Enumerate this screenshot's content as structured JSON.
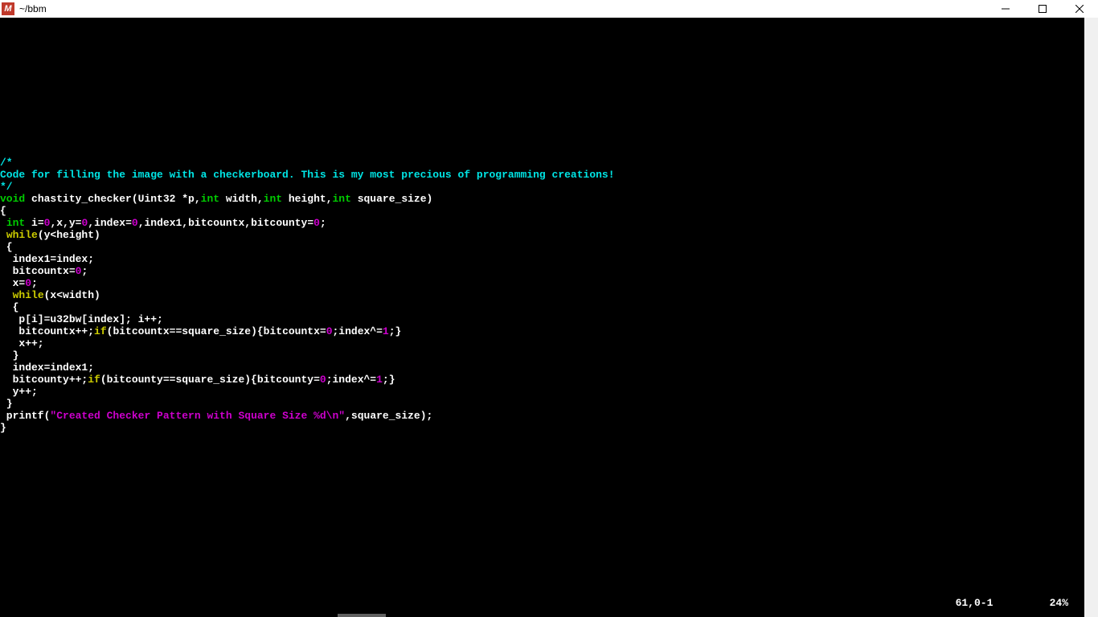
{
  "window": {
    "title": "~/bbm",
    "app_icon_letter": "M"
  },
  "status": {
    "pos": "61,0-1",
    "percent": "24%"
  },
  "code": {
    "l1_a": "/*",
    "l2_a": "Code for filling the image with a checkerboard. This is my most precious of programming creations!",
    "l3_a": "*/",
    "l4_void": "void",
    "l4_b": " chastity_checker(Uint32 *p,",
    "l4_int1": "int",
    "l4_c": " width,",
    "l4_int2": "int",
    "l4_d": " height,",
    "l4_int3": "int",
    "l4_e": " square_size)",
    "l5_a": "{",
    "l6_pad": " ",
    "l6_int": "int",
    "l6_b": " i=",
    "l6_n0a": "0",
    "l6_c": ",x,y=",
    "l6_n0b": "0",
    "l6_d": ",index=",
    "l6_n0c": "0",
    "l6_e": ",index1,bitcountx,bitcounty=",
    "l6_n0d": "0",
    "l6_f": ";",
    "l7_pad": " ",
    "l7_while": "while",
    "l7_b": "(y<height)",
    "l8_a": " {",
    "l9_a": "  index1=index;",
    "l10_a": "  bitcountx=",
    "l10_n": "0",
    "l10_b": ";",
    "l11_a": "  x=",
    "l11_n": "0",
    "l11_b": ";",
    "l12_pad": "  ",
    "l12_while": "while",
    "l12_b": "(x<width)",
    "l13_a": "  {",
    "l14_a": "   p[i]=u32bw[index]; i++;",
    "l15_a": "   bitcountx++;",
    "l15_if": "if",
    "l15_b": "(bitcountx==square_size){bitcountx=",
    "l15_n0": "0",
    "l15_c": ";index^=",
    "l15_n1": "1",
    "l15_d": ";}",
    "l16_a": "   x++;",
    "l17_a": "  }",
    "l18_a": "  index=index1;",
    "l19_a": "  bitcounty++;",
    "l19_if": "if",
    "l19_b": "(bitcounty==square_size){bitcounty=",
    "l19_n0": "0",
    "l19_c": ";index^=",
    "l19_n1": "1",
    "l19_d": ";}",
    "l20_a": "  y++;",
    "l21_a": " }",
    "l22_pad": " printf(",
    "l22_q1": "\"Created Checker Pattern with Square Size ",
    "l22_esc": "%d\\n",
    "l22_q2": "\"",
    "l22_b": ",square_size);",
    "l23_a": "}"
  }
}
